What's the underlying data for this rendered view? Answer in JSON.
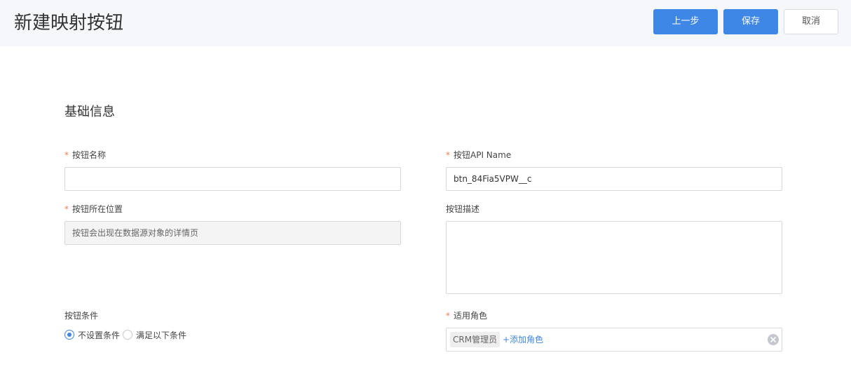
{
  "header": {
    "title": "新建映射按钮",
    "buttons": {
      "prev": "上一步",
      "save": "保存",
      "cancel": "取消"
    }
  },
  "form": {
    "section_title": "基础信息",
    "button_name": {
      "label": "按钮名称",
      "required": "*",
      "value": ""
    },
    "api_name": {
      "label": "按钮API Name",
      "required": "*",
      "value": "btn_84Fia5VPW__c"
    },
    "position": {
      "label": "按钮所在位置",
      "required": "*",
      "value": "按钮会出现在数据源对象的详情页"
    },
    "description": {
      "label": "按钮描述",
      "value": ""
    },
    "condition": {
      "label": "按钮条件",
      "options": [
        "不设置条件",
        "满足以下条件"
      ],
      "selected": "不设置条件"
    },
    "roles": {
      "label": "适用角色",
      "required": "*",
      "tags": [
        "CRM管理员"
      ],
      "add_label": "+添加角色"
    }
  },
  "colors": {
    "primary": "#3e87e6",
    "required": "#f07c4a",
    "header_bg": "#f5f7fa"
  }
}
